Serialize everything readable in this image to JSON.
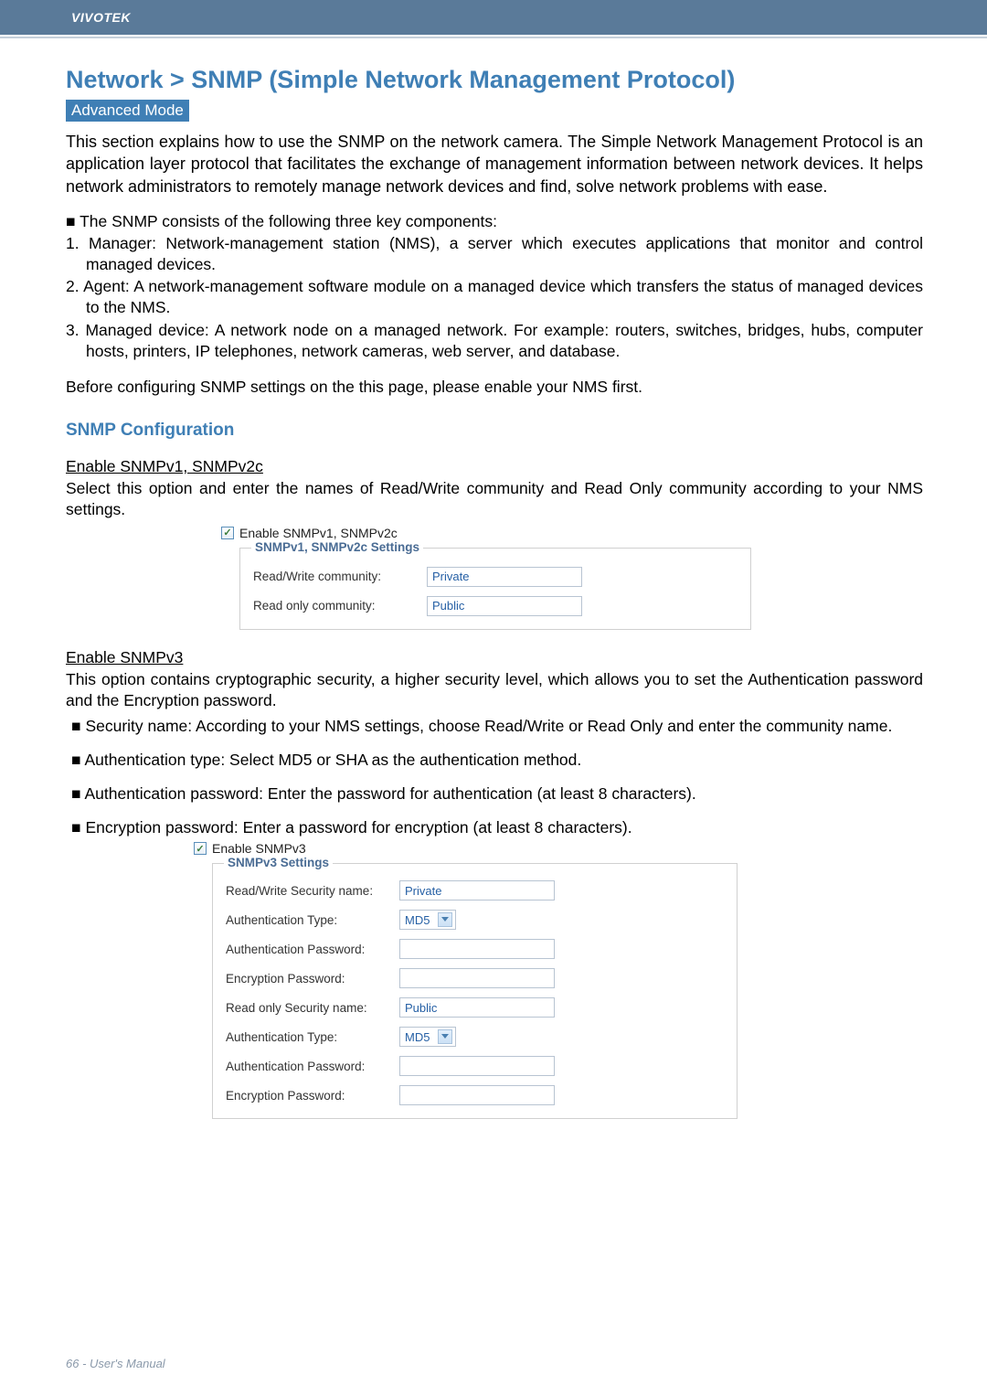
{
  "brand": "VIVOTEK",
  "title": "Network > SNMP (Simple Network Management Protocol)",
  "badge": "Advanced Mode",
  "intro": "This section explains how to use the SNMP on the network camera. The Simple Network Management Protocol is an application layer protocol that facilitates the exchange of management information between network devices. It helps network administrators to remotely manage network devices and find, solve network problems with ease.",
  "components_lead": "■ The SNMP consists of the following three key components:",
  "components": [
    "1. Manager: Network-management station (NMS), a server which executes applications that monitor and control managed devices.",
    "2. Agent: A network-management software module on a managed device which transfers the status of managed devices to the NMS.",
    "3. Managed device: A network node on a managed network. For example: routers, switches, bridges, hubs, computer hosts, printers, IP telephones, network cameras, web server, and database."
  ],
  "before_cfg": "Before configuring SNMP settings on the this page, please enable your NMS first.",
  "section_title": "SNMP Configuration",
  "v12": {
    "heading": "Enable SNMPv1, SNMPv2c",
    "desc": "Select this option and enter the names of Read/Write community and Read Only community according to your NMS settings.",
    "cb_label": "Enable SNMPv1, SNMPv2c",
    "legend": "SNMPv1, SNMPv2c Settings",
    "rw_label": "Read/Write community:",
    "rw_value": "Private",
    "ro_label": "Read only community:",
    "ro_value": "Public"
  },
  "v3": {
    "heading": "Enable SNMPv3",
    "desc": "This option contains cryptographic security, a higher security level, which allows you to set the Authentication password and the Encryption password.",
    "bullets": [
      "Security name: According to your NMS settings, choose Read/Write or Read Only and enter the community name.",
      "Authentication type: Select MD5 or SHA as the authentication method.",
      "Authentication password: Enter the password for authentication (at least 8 characters).",
      "Encryption password: Enter a password for encryption (at least 8 characters)."
    ],
    "cb_label": "Enable SNMPv3",
    "legend": "SNMPv3 Settings",
    "rw_sec_label": "Read/Write Security name:",
    "rw_sec_value": "Private",
    "auth_type_label": "Authentication Type:",
    "auth_type_value": "MD5",
    "auth_pw_label": "Authentication Password:",
    "enc_pw_label": "Encryption Password:",
    "ro_sec_label": "Read only Security name:",
    "ro_sec_value": "Public"
  },
  "footer": "66 - User's Manual"
}
